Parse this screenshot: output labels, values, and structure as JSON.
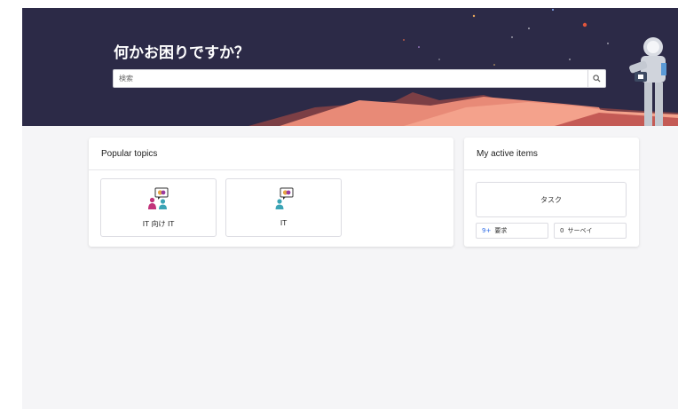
{
  "hero": {
    "title": "何かお困りですか？",
    "search_placeholder": "検索"
  },
  "popular_topics": {
    "title": "Popular topics",
    "items": [
      {
        "label": "IT 向け IT",
        "icon": "people-chat-icon"
      },
      {
        "label": "IT",
        "icon": "person-chat-icon"
      }
    ]
  },
  "active_items": {
    "title": "My active items",
    "task_label": "タスク",
    "requests": {
      "count": "9+",
      "label": "要求"
    },
    "surveys": {
      "count": "0",
      "label": "サーベイ"
    }
  },
  "colors": {
    "hero_bg": "#2c2a47",
    "count_accent": "#2e6be6"
  }
}
